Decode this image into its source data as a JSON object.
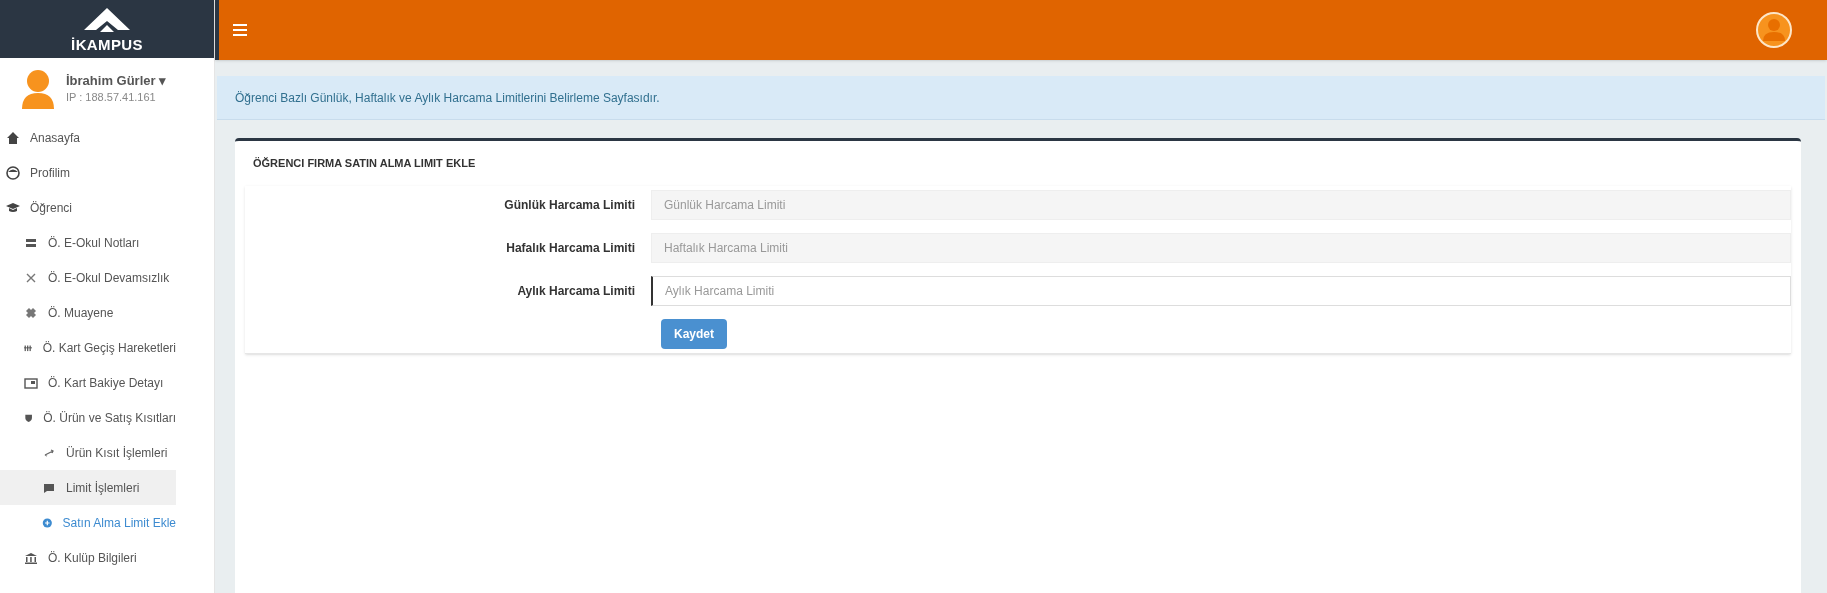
{
  "brand": {
    "name": "İKAMPUS"
  },
  "user": {
    "name": "İbrahim Gürler",
    "caret": "▾",
    "ip": "IP : 188.57.41.161"
  },
  "sidebar": {
    "items": [
      {
        "label": "Anasayfa",
        "selected": false,
        "highlighted": false
      },
      {
        "label": "Profilim",
        "selected": false,
        "highlighted": false
      },
      {
        "label": "Öğrenci",
        "selected": false,
        "highlighted": false,
        "children": [
          {
            "label": "Ö. E-Okul Notları",
            "selected": false,
            "highlighted": false
          },
          {
            "label": "Ö. E-Okul Devamsızlık",
            "selected": false,
            "highlighted": false
          },
          {
            "label": "Ö. Muayene",
            "selected": false,
            "highlighted": false
          },
          {
            "label": "Ö. Kart Geçiş Hareketleri",
            "selected": false,
            "highlighted": false
          },
          {
            "label": "Ö. Kart Bakiye Detayı",
            "selected": false,
            "highlighted": false
          },
          {
            "label": "Ö. Ürün ve Satış Kısıtları",
            "selected": false,
            "highlighted": false,
            "children": [
              {
                "label": "Ürün Kısıt İşlemleri",
                "selected": false,
                "highlighted": false
              },
              {
                "label": "Limit İşlemleri",
                "selected": false,
                "highlighted": true
              },
              {
                "label": "Satın Alma Limit Ekle",
                "selected": true,
                "highlighted": false
              }
            ]
          },
          {
            "label": "Ö. Kulüp Bilgileri",
            "selected": false,
            "highlighted": false
          }
        ]
      }
    ]
  },
  "info": {
    "text": "Öğrenci Bazlı Günlük, Haftalık ve Aylık Harcama Limitlerini Belirleme Sayfasıdır."
  },
  "card": {
    "title": "ÖĞRENCI FIRMA SATIN ALMA LIMIT EKLE",
    "fields": [
      {
        "label": "Günlük Harcama Limiti",
        "placeholder": "Günlük Harcama Limiti",
        "disabled": true,
        "focused": false
      },
      {
        "label": "Hafalık Harcama Limiti",
        "placeholder": "Haftalık Harcama Limiti",
        "disabled": true,
        "focused": false
      },
      {
        "label": "Aylık Harcama Limiti",
        "placeholder": "Aylık Harcama Limiti",
        "disabled": false,
        "focused": true
      }
    ],
    "button": "Kaydet"
  }
}
